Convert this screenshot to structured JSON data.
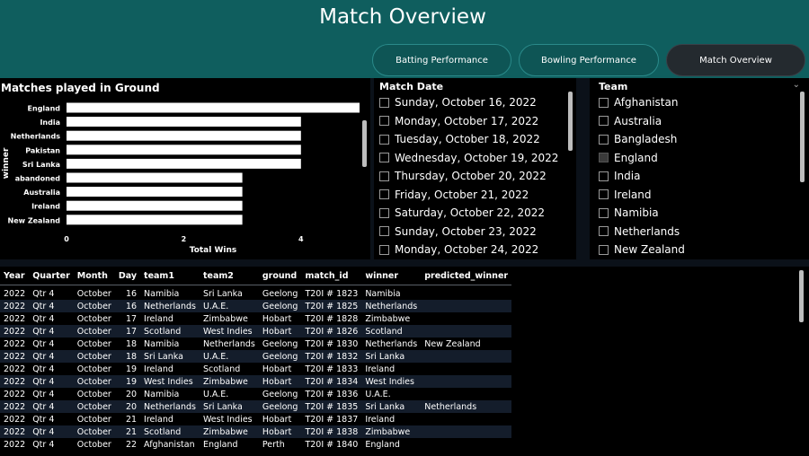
{
  "page_title": "Match Overview",
  "nav": {
    "batting": "Batting Performance",
    "bowling": "Bowling Performance",
    "match": "Match Overview"
  },
  "chart": {
    "title": "Matches played in Ground"
  },
  "chart_data": {
    "type": "bar",
    "orientation": "horizontal",
    "title": "Matches played in Ground",
    "xlabel": "Total Wins",
    "ylabel": "winner",
    "categories": [
      "England",
      "India",
      "Netherlands",
      "Pakistan",
      "Sri Lanka",
      "abandoned",
      "Australia",
      "Ireland",
      "New Zealand"
    ],
    "values": [
      5,
      4,
      4,
      4,
      4,
      3,
      3,
      3,
      3
    ],
    "x_ticks": [
      "0",
      "2",
      "4"
    ],
    "xlim": [
      0,
      5
    ],
    "bar_color": "#ffffff"
  },
  "match_date": {
    "title": "Match Date",
    "items": [
      "Sunday, October 16, 2022",
      "Monday, October 17, 2022",
      "Tuesday, October 18, 2022",
      "Wednesday, October 19, 2022",
      "Thursday, October 20, 2022",
      "Friday, October 21, 2022",
      "Saturday, October 22, 2022",
      "Sunday, October 23, 2022",
      "Monday, October 24, 2022"
    ]
  },
  "team": {
    "title": "Team",
    "items": [
      "Afghanistan",
      "Australia",
      "Bangladesh",
      "England",
      "India",
      "Ireland",
      "Namibia",
      "Netherlands",
      "New Zealand"
    ],
    "partial_index": 3
  },
  "table": {
    "columns": [
      "Year",
      "Quarter",
      "Month",
      "Day",
      "team1",
      "team2",
      "ground",
      "match_id",
      "winner",
      "predicted_winner"
    ],
    "rows": [
      [
        "2022",
        "Qtr 4",
        "October",
        "16",
        "Namibia",
        "Sri Lanka",
        "Geelong",
        "T20I # 1823",
        "Namibia",
        ""
      ],
      [
        "2022",
        "Qtr 4",
        "October",
        "16",
        "Netherlands",
        "U.A.E.",
        "Geelong",
        "T20I # 1825",
        "Netherlands",
        ""
      ],
      [
        "2022",
        "Qtr 4",
        "October",
        "17",
        "Ireland",
        "Zimbabwe",
        "Hobart",
        "T20I # 1828",
        "Zimbabwe",
        ""
      ],
      [
        "2022",
        "Qtr 4",
        "October",
        "17",
        "Scotland",
        "West Indies",
        "Hobart",
        "T20I # 1826",
        "Scotland",
        ""
      ],
      [
        "2022",
        "Qtr 4",
        "October",
        "18",
        "Namibia",
        "Netherlands",
        "Geelong",
        "T20I # 1830",
        "Netherlands",
        "New Zealand"
      ],
      [
        "2022",
        "Qtr 4",
        "October",
        "18",
        "Sri Lanka",
        "U.A.E.",
        "Geelong",
        "T20I # 1832",
        "Sri Lanka",
        ""
      ],
      [
        "2022",
        "Qtr 4",
        "October",
        "19",
        "Ireland",
        "Scotland",
        "Hobart",
        "T20I # 1833",
        "Ireland",
        ""
      ],
      [
        "2022",
        "Qtr 4",
        "October",
        "19",
        "West Indies",
        "Zimbabwe",
        "Hobart",
        "T20I # 1834",
        "West Indies",
        ""
      ],
      [
        "2022",
        "Qtr 4",
        "October",
        "20",
        "Namibia",
        "U.A.E.",
        "Geelong",
        "T20I # 1836",
        "U.A.E.",
        ""
      ],
      [
        "2022",
        "Qtr 4",
        "October",
        "20",
        "Netherlands",
        "Sri Lanka",
        "Geelong",
        "T20I # 1835",
        "Sri Lanka",
        "Netherlands"
      ],
      [
        "2022",
        "Qtr 4",
        "October",
        "21",
        "Ireland",
        "West Indies",
        "Hobart",
        "T20I # 1837",
        "Ireland",
        ""
      ],
      [
        "2022",
        "Qtr 4",
        "October",
        "21",
        "Scotland",
        "Zimbabwe",
        "Hobart",
        "T20I # 1838",
        "Zimbabwe",
        ""
      ],
      [
        "2022",
        "Qtr 4",
        "October",
        "22",
        "Afghanistan",
        "England",
        "Perth",
        "T20I # 1840",
        "England",
        ""
      ]
    ]
  },
  "colors": {
    "header_bg": "#0f5e5e",
    "page_bg": "#0b1119",
    "panel_bg": "#000000",
    "row_alt": "#141d2b"
  }
}
